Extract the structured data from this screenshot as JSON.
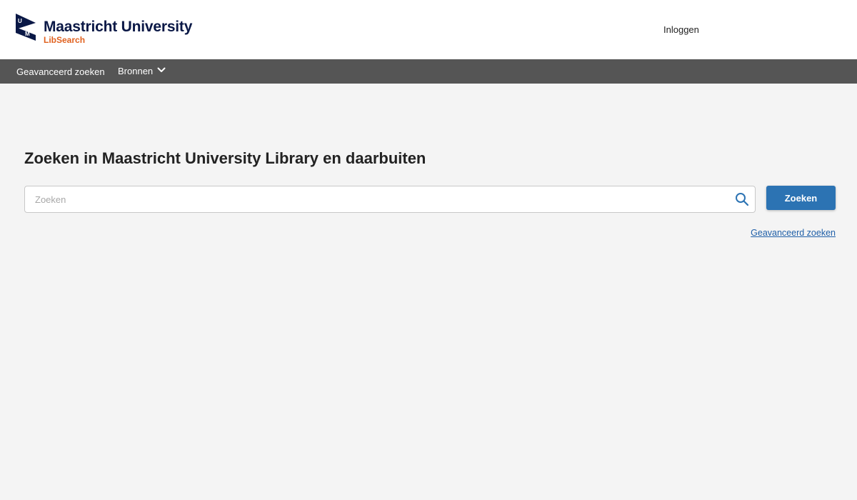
{
  "header": {
    "logo_name": "Maastricht University",
    "logo_sub": "LibSearch",
    "login_label": "Inloggen"
  },
  "nav": {
    "advanced_label": "Geavanceerd zoeken",
    "sources_label": "Bronnen"
  },
  "main": {
    "title": "Zoeken in Maastricht University Library en daarbuiten",
    "search": {
      "placeholder": "Zoeken",
      "value": ""
    },
    "search_button_label": "Zoeken",
    "advanced_link_label": "Geavanceerd zoeken"
  },
  "colors": {
    "brand_navy": "#0a1846",
    "brand_orange": "#e0611f",
    "navbar_bg": "#555555",
    "button_blue": "#2c73b3",
    "link_blue": "#1f5fa8"
  },
  "icons": {
    "logo": "um-logo-icon",
    "nav_dropdown": "chevron-down-icon",
    "search": "search-icon"
  }
}
